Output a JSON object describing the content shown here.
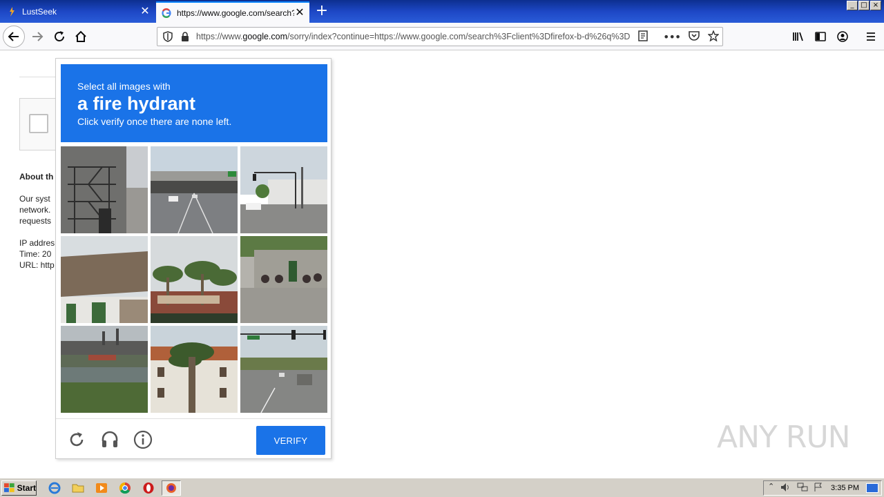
{
  "browser": {
    "tabs": [
      {
        "title": "LustSeek",
        "icon": "lustseek-favicon"
      },
      {
        "title": "https://www.google.com/search?c",
        "icon": "google-favicon",
        "active": true
      }
    ],
    "url_prefix": "https://www.",
    "url_domain": "google.com",
    "url_rest": "/sorry/index?continue=https://www.google.com/search%3Fclient%3Dfirefox-b-d%26q%3D",
    "window_controls": [
      "_",
      "□",
      "×"
    ]
  },
  "page": {
    "about_heading": "About th",
    "body_lines": [
      "Our syst",
      "network.",
      "requests"
    ],
    "info_lines": [
      "IP addres",
      "Time: 20",
      "URL: http"
    ]
  },
  "captcha": {
    "instruction_top": "Select all images with",
    "target": "a fire hydrant",
    "instruction_bottom": "Click verify once there are none left.",
    "verify_label": "VERIFY",
    "header_color": "#1a73e8",
    "tiles": [
      "fire-escape building",
      "highway overpass",
      "street with traffic light",
      "house roof",
      "palm trees with sign",
      "stone wall with scooters",
      "industrial waterfront",
      "palm tree and building",
      "road intersection with cars"
    ]
  },
  "watermark": "ANY RUN",
  "taskbar": {
    "start_label": "Start",
    "clock": "3:35 PM"
  }
}
